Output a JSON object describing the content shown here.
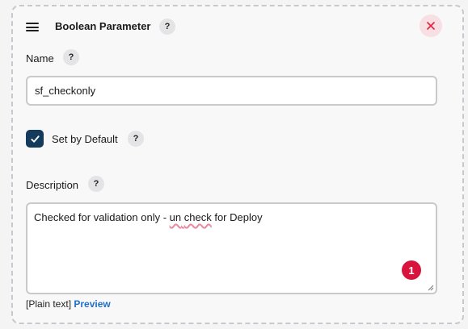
{
  "header": {
    "title": "Boolean Parameter",
    "help_label": "?",
    "drag_icon": "hamburger-menu-icon",
    "close_icon": "close-x-icon",
    "close_color": "#e0243f"
  },
  "name_field": {
    "label": "Name",
    "help_label": "?",
    "value": "sf_checkonly"
  },
  "default_checkbox": {
    "label": "Set by Default",
    "help_label": "?",
    "checked": true,
    "color": "#143a5c"
  },
  "description_field": {
    "label": "Description",
    "help_label": "?",
    "text_before": "Checked for validation only - ",
    "text_misspelled_1": "un",
    "text_space": " ",
    "text_misspelled_2": "check",
    "text_after": " for Deploy",
    "error_badge_count": "1",
    "error_badge_color": "#d8143d"
  },
  "footer": {
    "format_label": "[Plain text]",
    "preview_link": "Preview"
  }
}
